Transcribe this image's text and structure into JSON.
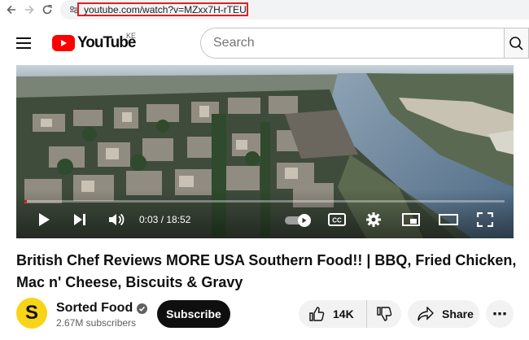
{
  "browser": {
    "url": "youtube.com/watch?v=MZxx7H-rTEU"
  },
  "header": {
    "logo_text": "YouTube",
    "country_code": "KE",
    "search_placeholder": "Search",
    "icons": {
      "menu": "hamburger-menu-icon",
      "search": "search-icon"
    }
  },
  "player": {
    "current_time": "0:03",
    "duration": "18:52",
    "time_display": "0:03 / 18:52",
    "progress_fraction": 0.003,
    "controls": [
      "play",
      "next",
      "volume",
      "autoplay",
      "captions",
      "settings",
      "miniplayer",
      "theater",
      "fullscreen"
    ],
    "captions_label": "CC",
    "accent_color": "#ff0000"
  },
  "video": {
    "title": "British Chef Reviews MORE USA Southern Food!! | BBQ, Fried Chicken, Mac n' Cheese, Biscuits & Gravy"
  },
  "channel": {
    "name": "Sorted Food",
    "avatar_letter": "S",
    "subscribers": "2.67M subscribers",
    "subscribe_label": "Subscribe",
    "verified": true
  },
  "actions": {
    "like_count": "14K",
    "share_label": "Share",
    "more_label": "⋯"
  }
}
